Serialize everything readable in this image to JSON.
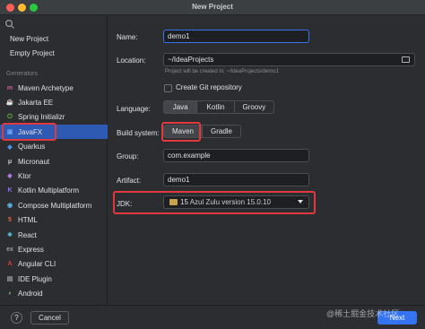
{
  "window": {
    "title": "New Project"
  },
  "sidebar": {
    "top_items": [
      {
        "label": "New Project"
      },
      {
        "label": "Empty Project"
      }
    ],
    "generators_heading": "Generators",
    "generators": [
      {
        "label": "Maven Archetype",
        "icon": "maven-icon",
        "glyph": "m",
        "color": "#c75ca0"
      },
      {
        "label": "Jakarta EE",
        "icon": "jakarta-icon",
        "glyph": "☕",
        "color": "#e8a33d"
      },
      {
        "label": "Spring Initializr",
        "icon": "spring-icon",
        "glyph": "⏻",
        "color": "#6db33f"
      },
      {
        "label": "JavaFX",
        "icon": "javafx-icon",
        "glyph": "▣",
        "color": "#6b9ff5"
      },
      {
        "label": "Quarkus",
        "icon": "quarkus-icon",
        "glyph": "◆",
        "color": "#4695eb"
      },
      {
        "label": "Micronaut",
        "icon": "micronaut-icon",
        "glyph": "μ",
        "color": "#c9ccd1"
      },
      {
        "label": "Ktor",
        "icon": "ktor-icon",
        "glyph": "◆",
        "color": "#b676e0"
      },
      {
        "label": "Kotlin Multiplatform",
        "icon": "kotlin-icon",
        "glyph": "K",
        "color": "#8f6ef5"
      },
      {
        "label": "Compose Multiplatform",
        "icon": "compose-icon",
        "glyph": "◉",
        "color": "#5fb4e6"
      },
      {
        "label": "HTML",
        "icon": "html-icon",
        "glyph": "5",
        "color": "#e36a3b"
      },
      {
        "label": "React",
        "icon": "react-icon",
        "glyph": "⚛",
        "color": "#5fd3f3"
      },
      {
        "label": "Express",
        "icon": "express-icon",
        "glyph": "ex",
        "color": "#9da0a6"
      },
      {
        "label": "Angular CLI",
        "icon": "angular-icon",
        "glyph": "A",
        "color": "#dd3b3b"
      },
      {
        "label": "IDE Plugin",
        "icon": "plugin-icon",
        "glyph": "▤",
        "color": "#9da0a6"
      },
      {
        "label": "Android",
        "icon": "android-icon",
        "glyph": "◗",
        "color": "#7cc35a"
      }
    ],
    "selected": "JavaFX"
  },
  "form": {
    "name_label": "Name:",
    "name_value": "demo1",
    "location_label": "Location:",
    "location_value": "~/IdeaProjects",
    "location_hint": "Project will be created in: ~/IdeaProjects/demo1",
    "git_label": "Create Git repository",
    "language_label": "Language:",
    "languages": [
      "Java",
      "Kotlin",
      "Groovy"
    ],
    "language_selected": "Java",
    "build_label": "Build system:",
    "build_systems": [
      "Maven",
      "Gradle"
    ],
    "build_selected": "Maven",
    "group_label": "Group:",
    "group_value": "com.example",
    "artifact_label": "Artifact:",
    "artifact_value": "demo1",
    "jdk_label": "JDK:",
    "jdk_version": "15",
    "jdk_value": "Azul Zulu version 15.0.10"
  },
  "footer": {
    "help": "?",
    "cancel": "Cancel",
    "next": "Next"
  },
  "watermark": "@稀土掘金技术社区",
  "colors": {
    "accent": "#3574f0",
    "selection": "#2e5ab3",
    "highlight": "#e0393e"
  }
}
